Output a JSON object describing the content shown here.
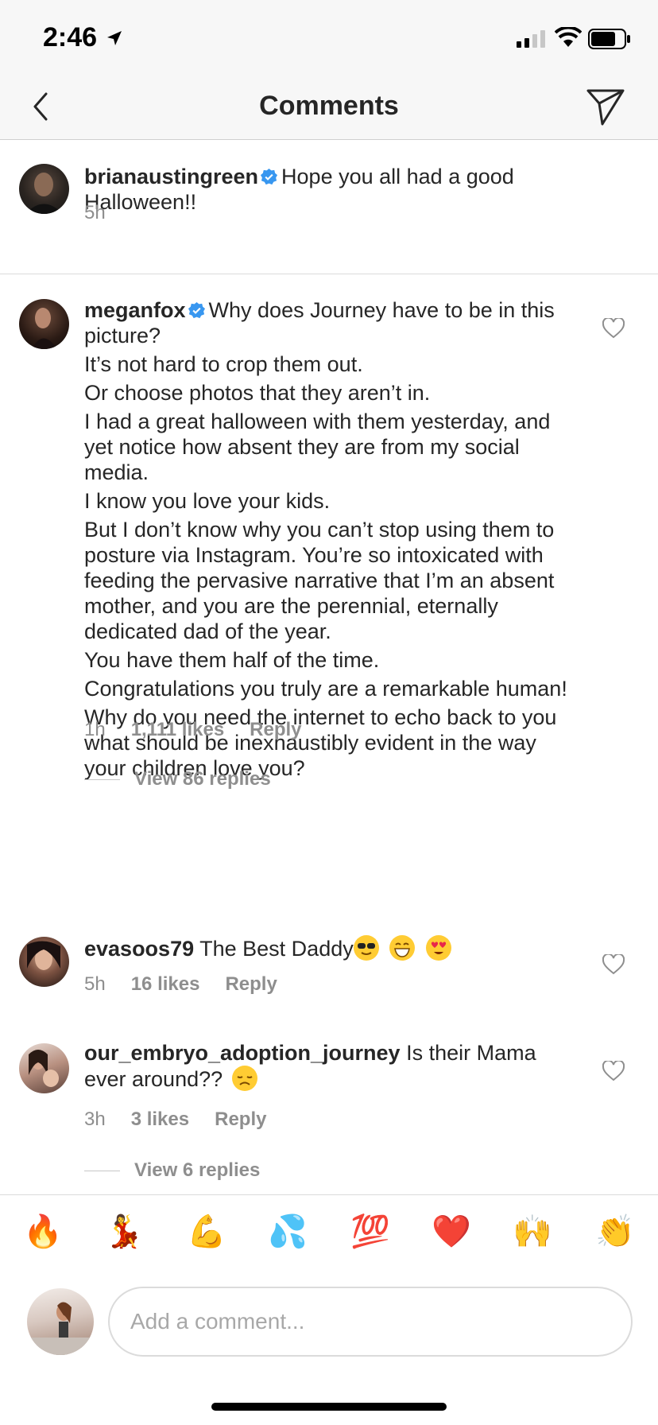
{
  "status_bar": {
    "time": "2:46"
  },
  "nav": {
    "title": "Comments"
  },
  "caption": {
    "username": "brianaustingreen",
    "text": "Hope you all had a good Halloween!!",
    "time": "5h"
  },
  "comments": [
    {
      "username": "meganfox",
      "paragraphs": [
        "Why does Journey have to be in this picture?",
        "It’s not hard to crop them out.",
        "Or choose photos that they aren’t in.",
        "I had a great halloween with them yesterday, and yet notice how absent they are from my social media.",
        "I know you love your kids.",
        "But I don’t know why you can’t stop using them to posture via Instagram. You’re so intoxicated with feeding the pervasive narrative that I’m an absent mother, and you are the perennial, eternally dedicated dad of the year.",
        "You have them half of the time.",
        "Congratulations you truly are a remarkable human!",
        "Why do you need the internet to echo back to you what should be inexhaustibly evident in the way your children love you?"
      ],
      "time": "1h",
      "likes": "1,111 likes",
      "reply": "Reply",
      "view_replies": "View 86 replies"
    },
    {
      "username": "evasoos79",
      "text": "The Best Daddy",
      "emojis": [
        "😎",
        "😁",
        "😍"
      ],
      "time": "5h",
      "likes": "16 likes",
      "reply": "Reply"
    },
    {
      "username": "our_embryo_adoption_journey",
      "text": "Is their Mama ever around??",
      "emojis": [
        "😞"
      ],
      "time": "3h",
      "likes": "3 likes",
      "reply": "Reply",
      "view_replies": "View 6 replies"
    }
  ],
  "emoji_bar": [
    "🔥",
    "💃",
    "💪",
    "💦",
    "💯",
    "❤️",
    "🙌",
    "👏"
  ],
  "input": {
    "placeholder": "Add a comment..."
  },
  "colors": {
    "meta": "#8e8e8e",
    "verified": "#3897f0",
    "divider": "#dbdbdb"
  }
}
